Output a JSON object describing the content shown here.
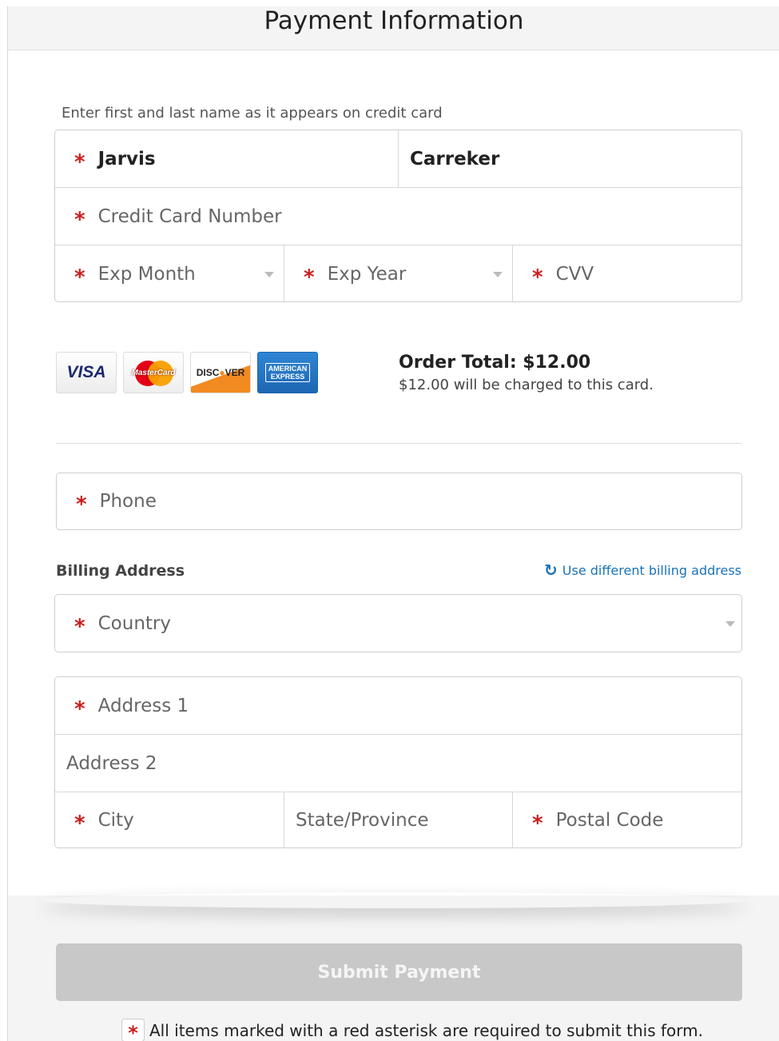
{
  "header": {
    "title": "Payment Information"
  },
  "card_section": {
    "hint": "Enter first and last name as it appears on credit card",
    "first_name": {
      "value": "Jarvis",
      "required": true
    },
    "last_name": {
      "value": "Carreker",
      "required": false
    },
    "card_number": {
      "placeholder": "Credit Card Number",
      "required": true
    },
    "exp_month": {
      "placeholder": "Exp Month",
      "required": true
    },
    "exp_year": {
      "placeholder": "Exp Year",
      "required": true
    },
    "cvv": {
      "placeholder": "CVV",
      "required": true
    }
  },
  "card_logos": [
    {
      "name": "visa",
      "text": "VISA"
    },
    {
      "name": "mastercard",
      "text": "MasterCard"
    },
    {
      "name": "discover",
      "text_pre": "DISC",
      "text_o": "●",
      "text_post": "VER"
    },
    {
      "name": "american-express",
      "text_line1": "AMERICAN",
      "text_line2": "EXPRESS"
    }
  ],
  "order": {
    "total_label": "Order Total: $12.00",
    "charge_note": "$12.00 will be charged to this card."
  },
  "phone": {
    "placeholder": "Phone",
    "required": true
  },
  "billing": {
    "label": "Billing Address",
    "different_link": "Use different billing address",
    "country": {
      "placeholder": "Country",
      "required": true
    },
    "address1": {
      "placeholder": "Address 1",
      "required": true
    },
    "address2": {
      "placeholder": "Address 2",
      "required": false
    },
    "city": {
      "placeholder": "City",
      "required": true
    },
    "state": {
      "placeholder": "State/Province",
      "required": false
    },
    "postal": {
      "placeholder": "Postal Code",
      "required": true
    }
  },
  "submit": {
    "label": "Submit Payment"
  },
  "required_note": {
    "asterisk": "*",
    "text": "All items marked with a red asterisk are required to submit this form."
  },
  "colors": {
    "required_asterisk": "#cc1f1f",
    "link": "#1a73b8",
    "submit_disabled": "#c8c8c8",
    "header_bg": "#f4f4f4"
  }
}
